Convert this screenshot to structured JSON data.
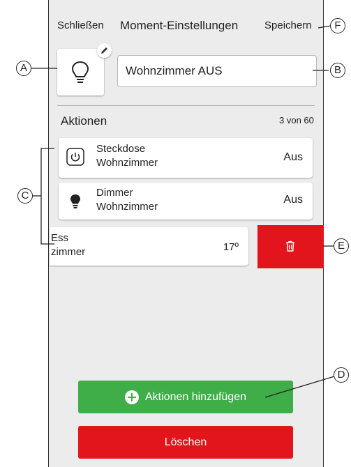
{
  "header": {
    "close_label": "Schließen",
    "title": "Moment-Einstellungen",
    "save_label": "Speichern"
  },
  "moment": {
    "icon": "lightbulb-icon",
    "edit_icon": "pencil-icon",
    "name_value": "Wohnzimmer AUS"
  },
  "actions_section": {
    "title": "Aktionen",
    "count": "3 von 60",
    "items": [
      {
        "icon": "power-icon",
        "label_line1": "Steckdose",
        "label_line2": "Wohnzimmer",
        "value": "Aus"
      },
      {
        "icon": "lightbulb-filled-icon",
        "label_line1": "Dimmer",
        "label_line2": "Wohnzimmer",
        "value": "Aus"
      },
      {
        "label_line1": "Ess",
        "label_line2": "zimmer",
        "value": "17º"
      }
    ]
  },
  "swipe_delete": {
    "icon": "trash-icon"
  },
  "buttons": {
    "add_actions": "Aktionen hinzufügen",
    "delete": "Löschen"
  },
  "callouts": {
    "a": "A",
    "b": "B",
    "c": "C",
    "d": "D",
    "e": "E",
    "f": "F"
  },
  "colors": {
    "background": "#ececec",
    "green": "#3fae49",
    "red": "#e2151d"
  }
}
